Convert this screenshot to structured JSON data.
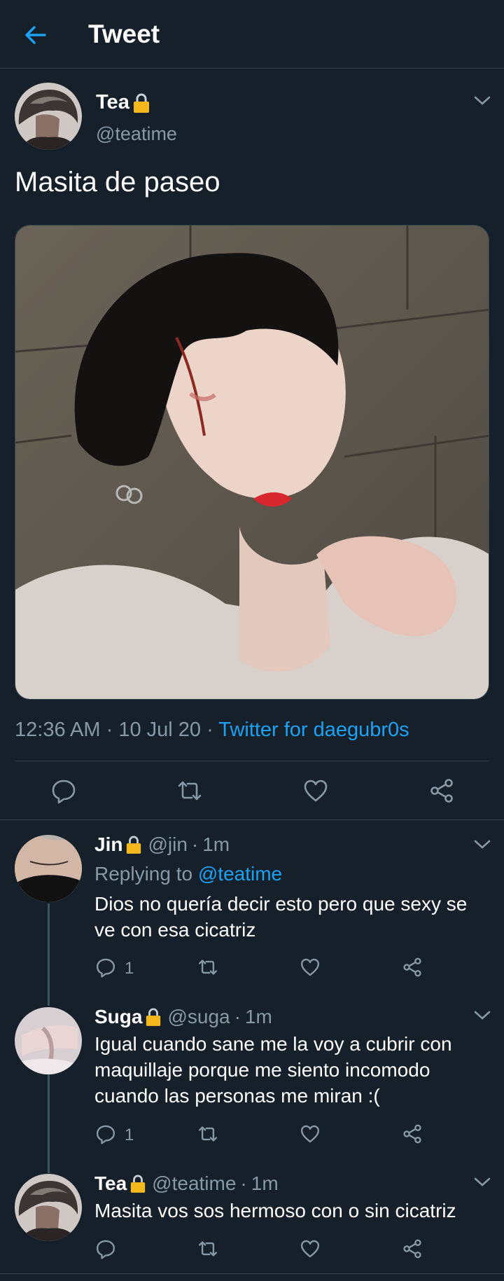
{
  "header": {
    "title": "Tweet",
    "back_icon": "arrow-left-icon"
  },
  "main_tweet": {
    "name": "Tea",
    "handle": "@teatime",
    "text": "Masita de paseo",
    "time": "12:36 AM",
    "date": "10 Jul 20",
    "separator": " · ",
    "source": "Twitter for daegubr0s",
    "actions": [
      "reply-icon",
      "retweet-icon",
      "like-icon",
      "share-icon"
    ]
  },
  "replies": [
    {
      "name": "Jin",
      "handle": "@jin",
      "time": "1m",
      "replying_to_label": "Replying to",
      "replying_to_handle": "@teatime",
      "text": "Dios no quería decir esto pero que sexy se ve con esa cicatriz",
      "reply_count": "1"
    },
    {
      "name": "Suga",
      "handle": "@suga",
      "time": "1m",
      "text": "Igual cuando sane me la voy a cubrir con maquillaje porque me siento incomodo cuando las personas me miran :(",
      "reply_count": "1"
    },
    {
      "name": "Tea",
      "handle": "@teatime",
      "time": "1m",
      "text": "Masita vos sos hermoso con o sin cicatriz"
    }
  ],
  "colors": {
    "background": "#15202b",
    "accent": "#1da1f2",
    "secondary_text": "#8899a6",
    "divider": "#38444d",
    "lock": "#f5b91e"
  }
}
